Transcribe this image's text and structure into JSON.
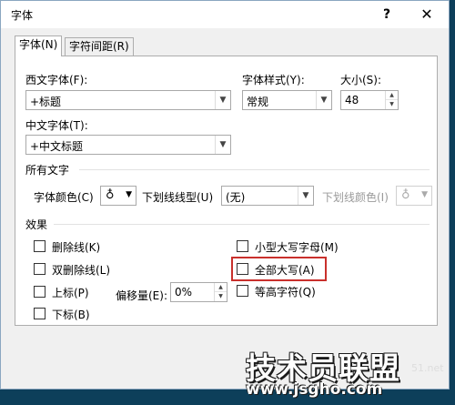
{
  "window": {
    "title": "字体",
    "help": "?",
    "close": "✕"
  },
  "tabs": [
    {
      "label": "字体(N)",
      "active": true
    },
    {
      "label": "字符间距(R)",
      "active": false
    }
  ],
  "fonts": {
    "western_label": "西文字体(F):",
    "western_value": "+标题",
    "style_label": "字体样式(Y):",
    "style_value": "常规",
    "size_label": "大小(S):",
    "size_value": "48",
    "asian_label": "中文字体(T):",
    "asian_value": "+中文标题"
  },
  "all_text": {
    "section": "所有文字",
    "font_color_label": "字体颜色(C)",
    "underline_style_label": "下划线线型(U)",
    "underline_style_value": "(无)",
    "underline_color_label": "下划线颜色(I)"
  },
  "effects": {
    "section": "效果",
    "strikethrough": "删除线(K)",
    "double_strikethrough": "双删除线(L)",
    "superscript": "上标(P)",
    "offset_label": "偏移量(E):",
    "offset_value": "0%",
    "subscript": "下标(B)",
    "small_caps": "小型大写字母(M)",
    "all_caps": "全部大写(A)",
    "equalize_height": "等高字符(Q)"
  },
  "watermark": {
    "brand": "技术员联盟",
    "url": "www.jsgho.com",
    "small": "51.net"
  },
  "colors": {
    "highlight": "#c9302c",
    "background": "#0d3f5a"
  }
}
